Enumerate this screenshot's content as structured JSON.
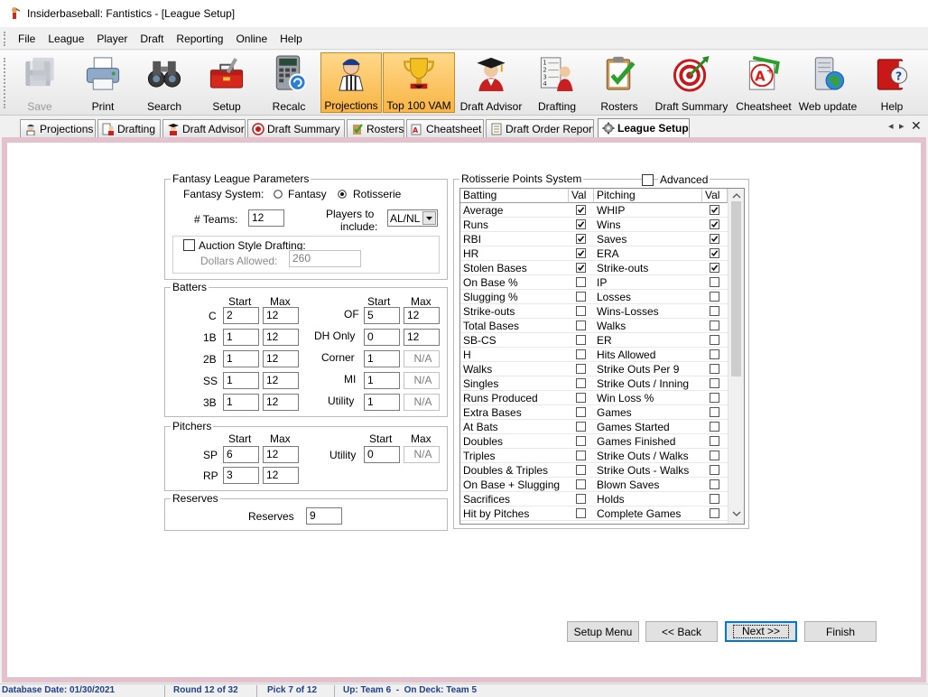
{
  "window": {
    "title": "Insiderbaseball: Fantistics - [League Setup]"
  },
  "menu": [
    "File",
    "League",
    "Player",
    "Draft",
    "Reporting",
    "Online",
    "Help"
  ],
  "toolbar": [
    {
      "label": "Save",
      "icon": "floppy-disk-icon",
      "disabled": true
    },
    {
      "label": "Print",
      "icon": "printer-icon"
    },
    {
      "label": "Search",
      "icon": "binoculars-icon"
    },
    {
      "label": "Setup",
      "icon": "toolbox-icon"
    },
    {
      "label": "Recalc",
      "icon": "calculator-icon"
    },
    {
      "label": "Projections",
      "icon": "umpire-icon",
      "active": true
    },
    {
      "label": "Top 100 VAM",
      "icon": "trophy-icon",
      "active": true
    },
    {
      "label": "Draft Advisor",
      "icon": "graduate-icon"
    },
    {
      "label": "Drafting",
      "icon": "draft-board-icon"
    },
    {
      "label": "Rosters",
      "icon": "clipboard-check-icon"
    },
    {
      "label": "Draft Summary",
      "icon": "target-icon"
    },
    {
      "label": "Cheatsheet",
      "icon": "grade-a-plus-icon"
    },
    {
      "label": "Web update",
      "icon": "server-globe-icon"
    },
    {
      "label": "Help",
      "icon": "help-book-icon"
    }
  ],
  "tabs": [
    {
      "label": "Projections",
      "icon": "umpire-icon"
    },
    {
      "label": "Drafting",
      "icon": "draft-board-icon"
    },
    {
      "label": "Draft Advisor",
      "icon": "graduate-icon"
    },
    {
      "label": "Draft Summary",
      "icon": "target-icon"
    },
    {
      "label": "Rosters",
      "icon": "clipboard-check-icon"
    },
    {
      "label": "Cheatsheet",
      "icon": "grade-a-plus-icon"
    },
    {
      "label": "Draft Order Report",
      "icon": "report-icon"
    },
    {
      "label": "League Setup",
      "icon": "gear-icon",
      "active": true
    }
  ],
  "league_params": {
    "title": "Fantasy League Parameters",
    "system_label": "Fantasy System:",
    "option_fantasy": "Fantasy",
    "option_roto": "Rotisserie",
    "selected_system": "Rotisserie",
    "teams_label": "# Teams:",
    "teams_value": "12",
    "players_label_1": "Players to",
    "players_label_2": "include:",
    "players_value": "AL/NL",
    "auction_label": "Auction Style Drafting:",
    "auction_checked": false,
    "dollars_label": "Dollars Allowed:",
    "dollars_value": "260"
  },
  "batters": {
    "title": "Batters",
    "start_header": "Start",
    "max_header": "Max",
    "left": [
      {
        "pos": "C",
        "start": "2",
        "max": "12"
      },
      {
        "pos": "1B",
        "start": "1",
        "max": "12"
      },
      {
        "pos": "2B",
        "start": "1",
        "max": "12"
      },
      {
        "pos": "SS",
        "start": "1",
        "max": "12"
      },
      {
        "pos": "3B",
        "start": "1",
        "max": "12"
      }
    ],
    "right": [
      {
        "pos": "OF",
        "start": "5",
        "max": "12"
      },
      {
        "pos": "DH Only",
        "start": "0",
        "max": "12"
      },
      {
        "pos": "Corner",
        "start": "1",
        "max": "N/A"
      },
      {
        "pos": "MI",
        "start": "1",
        "max": "N/A"
      },
      {
        "pos": "Utility",
        "start": "1",
        "max": "N/A"
      }
    ]
  },
  "pitchers": {
    "title": "Pitchers",
    "start_header": "Start",
    "max_header": "Max",
    "sp_label": "SP",
    "sp_start": "6",
    "sp_max": "12",
    "rp_label": "RP",
    "rp_start": "3",
    "rp_max": "12",
    "utility_label": "Utility",
    "utility_start": "0",
    "utility_max": "N/A"
  },
  "reserves": {
    "title": "Reserves",
    "label": "Reserves",
    "value": "9"
  },
  "roto": {
    "title": "Rotisserie Points System",
    "advanced_label": "Advanced",
    "advanced_checked": false,
    "batting_header": "Batting",
    "pitching_header": "Pitching",
    "val_header": "Val",
    "batting": [
      {
        "name": "Average",
        "checked": true
      },
      {
        "name": "Runs",
        "checked": true
      },
      {
        "name": "RBI",
        "checked": true
      },
      {
        "name": "HR",
        "checked": true
      },
      {
        "name": "Stolen Bases",
        "checked": true
      },
      {
        "name": "On Base %",
        "checked": false
      },
      {
        "name": "Slugging %",
        "checked": false
      },
      {
        "name": "Strike-outs",
        "checked": false
      },
      {
        "name": "Total Bases",
        "checked": false
      },
      {
        "name": "SB-CS",
        "checked": false
      },
      {
        "name": "H",
        "checked": false
      },
      {
        "name": "Walks",
        "checked": false
      },
      {
        "name": "Singles",
        "checked": false
      },
      {
        "name": "Runs Produced",
        "checked": false
      },
      {
        "name": "Extra Bases",
        "checked": false
      },
      {
        "name": "At Bats",
        "checked": false
      },
      {
        "name": "Doubles",
        "checked": false
      },
      {
        "name": "Triples",
        "checked": false
      },
      {
        "name": "Doubles & Triples",
        "checked": false
      },
      {
        "name": "On Base + Slugging",
        "checked": false
      },
      {
        "name": "Sacrifices",
        "checked": false
      },
      {
        "name": "Hit by Pitches",
        "checked": false
      }
    ],
    "pitching": [
      {
        "name": "WHIP",
        "checked": true
      },
      {
        "name": "Wins",
        "checked": true
      },
      {
        "name": "Saves",
        "checked": true
      },
      {
        "name": "ERA",
        "checked": true
      },
      {
        "name": "Strike-outs",
        "checked": true
      },
      {
        "name": "IP",
        "checked": false
      },
      {
        "name": "Losses",
        "checked": false
      },
      {
        "name": "Wins-Losses",
        "checked": false
      },
      {
        "name": "Walks",
        "checked": false
      },
      {
        "name": "ER",
        "checked": false
      },
      {
        "name": "Hits Allowed",
        "checked": false
      },
      {
        "name": "Strike Outs Per 9",
        "checked": false
      },
      {
        "name": "Strike Outs / Inning",
        "checked": false
      },
      {
        "name": "Win Loss %",
        "checked": false
      },
      {
        "name": "Games",
        "checked": false
      },
      {
        "name": "Games Started",
        "checked": false
      },
      {
        "name": "Games Finished",
        "checked": false
      },
      {
        "name": "Strike Outs / Walks",
        "checked": false
      },
      {
        "name": "Strike Outs - Walks",
        "checked": false
      },
      {
        "name": "Blown Saves",
        "checked": false
      },
      {
        "name": "Holds",
        "checked": false
      },
      {
        "name": "Complete Games",
        "checked": false
      }
    ]
  },
  "buttons": {
    "setup_menu": "Setup Menu",
    "back": "<< Back",
    "next": "Next >>",
    "finish": "Finish"
  },
  "status": {
    "database_date": "Database Date: 01/30/2021",
    "round": "Round 12 of 32",
    "pick": "Pick 7 of 12",
    "up": "Up: Team 6  -  On Deck: Team 5"
  },
  "colors": {
    "content_border": "#e3c1cd",
    "active_toolbar": "#f8b545",
    "status_text": "#1e3f8a",
    "default_button_border": "#0078d7"
  }
}
